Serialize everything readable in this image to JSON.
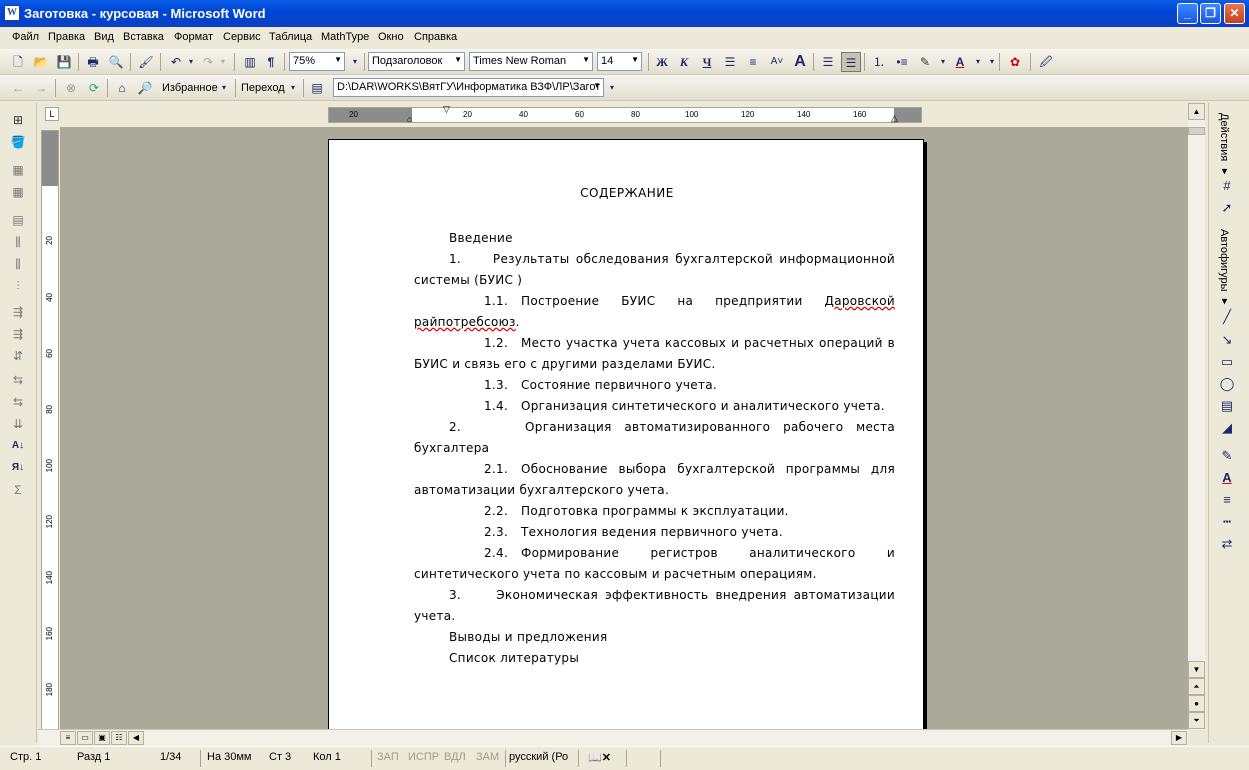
{
  "window": {
    "title": "Заготовка - курсовая - Microsoft Word",
    "app_icon": "W"
  },
  "menu": [
    "Файл",
    "Правка",
    "Вид",
    "Вставка",
    "Формат",
    "Сервис",
    "Таблица",
    "MathType",
    "Окно",
    "Справка"
  ],
  "toolbar_standard": {
    "zoom": "75%"
  },
  "toolbar_format": {
    "style": "Подзаголовок",
    "font": "Times New Roman",
    "size": "14",
    "bold": "Ж",
    "italic": "К",
    "underline": "Ч"
  },
  "toolbar_web": {
    "favorites": "Избранное",
    "go": "Переход",
    "address": "D:\\DAR\\WORKS\\ВятГУ\\Информатика ВЗФ\\ЛР\\Загот"
  },
  "ruler": {
    "tab_selector": "L",
    "h_marks": [
      "20",
      "20",
      "40",
      "60",
      "80",
      "100",
      "120",
      "140",
      "160"
    ],
    "v_marks": [
      "20",
      "40",
      "60",
      "80",
      "100",
      "120",
      "140",
      "160",
      "180"
    ]
  },
  "document": {
    "heading": "СОДЕРЖАНИЕ",
    "intro": "Введение",
    "items": [
      {
        "num": "1.",
        "text": "Результаты обследования бухгалтерской информационной системы (БУИС )"
      },
      {
        "num": "1.1.",
        "text_a": "Построение БУИС на предприятии",
        "text_b": "Даровской райпотребсоюз",
        "text_c": "."
      },
      {
        "num": "1.2.",
        "text": "Место участка учета кассовых и расчетных операций в БУИС и связь его с другими разделами БУИС."
      },
      {
        "num": "1.3.",
        "text": "Состояние первичного учета."
      },
      {
        "num": "1.4.",
        "text": "Организация синтетического и аналитического учета."
      },
      {
        "num": "2.",
        "text": "Организация автоматизированного рабочего места бухгалтера"
      },
      {
        "num": "2.1.",
        "text": "Обоснование выбора бухгалтерской программы для автоматизации бухгалтерского учета."
      },
      {
        "num": "2.2.",
        "text": "Подготовка программы к эксплуатации."
      },
      {
        "num": "2.3.",
        "text": "Технология ведения первичного учета."
      },
      {
        "num": "2.4.",
        "text": "Формирование регистров аналитического и синтетического учета по кассовым и расчетным операциям."
      },
      {
        "num": "3.",
        "text": "Экономическая эффективность внедрения автоматизации учета."
      }
    ],
    "conclusion": "Выводы и предложения",
    "references": "Список литературы"
  },
  "right_panel": {
    "actions": "Действия ▾",
    "autoshapes": "Автофигуры ▾"
  },
  "status": {
    "page": "Стр. 1",
    "section": "Разд 1",
    "pages": "1/34",
    "at": "На 30мм",
    "line": "Ст 3",
    "col": "Кол 1",
    "rec": "ЗАП",
    "trk": "ИСПР",
    "ext": "ВДЛ",
    "ovr": "ЗАМ",
    "lang": "русский (Ро"
  }
}
